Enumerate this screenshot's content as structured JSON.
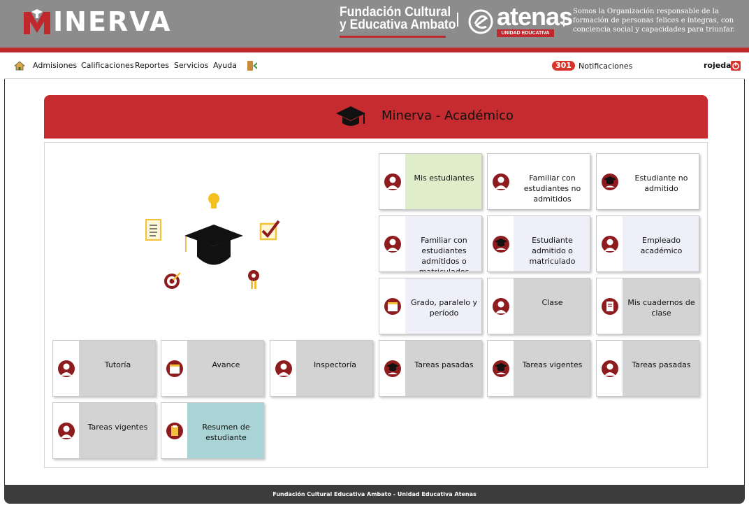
{
  "header": {
    "logo_text": "INERVA",
    "foundation_line1": "Fundación Cultural",
    "foundation_line2": "y Educativa Ambato",
    "school_name": "atenas",
    "school_badge": "UNIDAD EDUCATIVA",
    "mission": "Somos la Organización responsable de la formación de personas felices e íntegras, con conciencia social y capacidades para triunfar."
  },
  "nav": {
    "items": [
      "Admisiones",
      "Calificaciones",
      "Reportes",
      "Servicios",
      "Ayuda"
    ],
    "notifications_count": "301",
    "notifications_label": "Notificaciones",
    "user": "rojeda"
  },
  "module": {
    "title": "Minerva - Académico"
  },
  "tiles": [
    {
      "label": "Mis estudiantes",
      "icon": "student-reading-icon",
      "bg": "#e0edca"
    },
    {
      "label": "Familiar con estudiantes no admitidos",
      "icon": "family-pending-icon",
      "bg": "#ffffff"
    },
    {
      "label": "Estudiante no admitido",
      "icon": "graduate-icon",
      "bg": "#ffffff"
    },
    {
      "label": "Familiar con estudiantes admitidos o matriculados",
      "icon": "family-approved-icon",
      "bg": "#eeeff8"
    },
    {
      "label": "Estudiante admitido o matriculado",
      "icon": "graduate-checked-icon",
      "bg": "#eeeff8"
    },
    {
      "label": "Empleado académico",
      "icon": "teacher-icon",
      "bg": "#eeeff8"
    },
    {
      "label": "Grado, paralelo y período",
      "icon": "calendar-grade-icon",
      "bg": "#eeeff8"
    },
    {
      "label": "Clase",
      "icon": "classroom-icon",
      "bg": "#d3d3d3"
    },
    {
      "label": "Mis cuadernos de clase",
      "icon": "notebook-icon",
      "bg": "#d3d3d3"
    },
    {
      "label": "Tutoría",
      "icon": "tutor-icon",
      "bg": "#d3d3d3"
    },
    {
      "label": "Avance",
      "icon": "progress-calendar-icon",
      "bg": "#d3d3d3"
    },
    {
      "label": "Inspectoría",
      "icon": "inspector-icon",
      "bg": "#d3d3d3"
    },
    {
      "label": "Tareas pasadas",
      "icon": "graduate-book-icon",
      "bg": "#d3d3d3"
    },
    {
      "label": "Tareas vigentes",
      "icon": "graduate-book-icon",
      "bg": "#d3d3d3"
    },
    {
      "label": "Tareas pasadas",
      "icon": "student-writing-icon",
      "bg": "#d3d3d3"
    },
    {
      "label": "Tareas vigentes",
      "icon": "student-writing-icon",
      "bg": "#d3d3d3"
    },
    {
      "label": "Resumen de estudiante",
      "icon": "clipboard-icon",
      "bg": "#a9d3d4"
    }
  ],
  "footer": {
    "text": "Fundación Cultural Educativa Ambato - Unidad Educativa Atenas"
  },
  "colors": {
    "brand_red": "#c62b2f",
    "icon_maroon": "#8e1b1e",
    "header_gray": "#8c8c8c",
    "footer_dark": "#3c3c3c"
  }
}
